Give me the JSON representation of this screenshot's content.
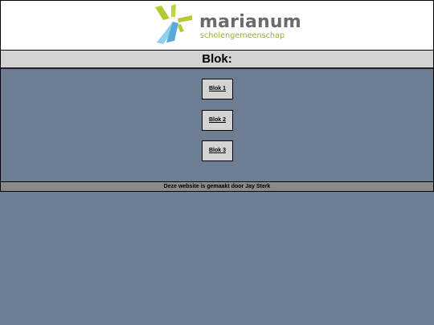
{
  "header": {
    "logo_name": "marianum",
    "logo_subtitle": "scholengemeenschap",
    "logo_colors": [
      "#b5c934",
      "#8ed1e8",
      "#5aa9d6"
    ]
  },
  "title": "Blok:",
  "blocks": [
    {
      "label": "Blok 1"
    },
    {
      "label": "Blok 2"
    },
    {
      "label": "Blok 3"
    }
  ],
  "footer": {
    "text": "Deze website is gemaakt door Jay Sterk"
  },
  "colors": {
    "background": "#6e7e92",
    "title_bar": "#d3d3d3",
    "footer": "#8a8a8a",
    "button": "#d3d3d3"
  }
}
